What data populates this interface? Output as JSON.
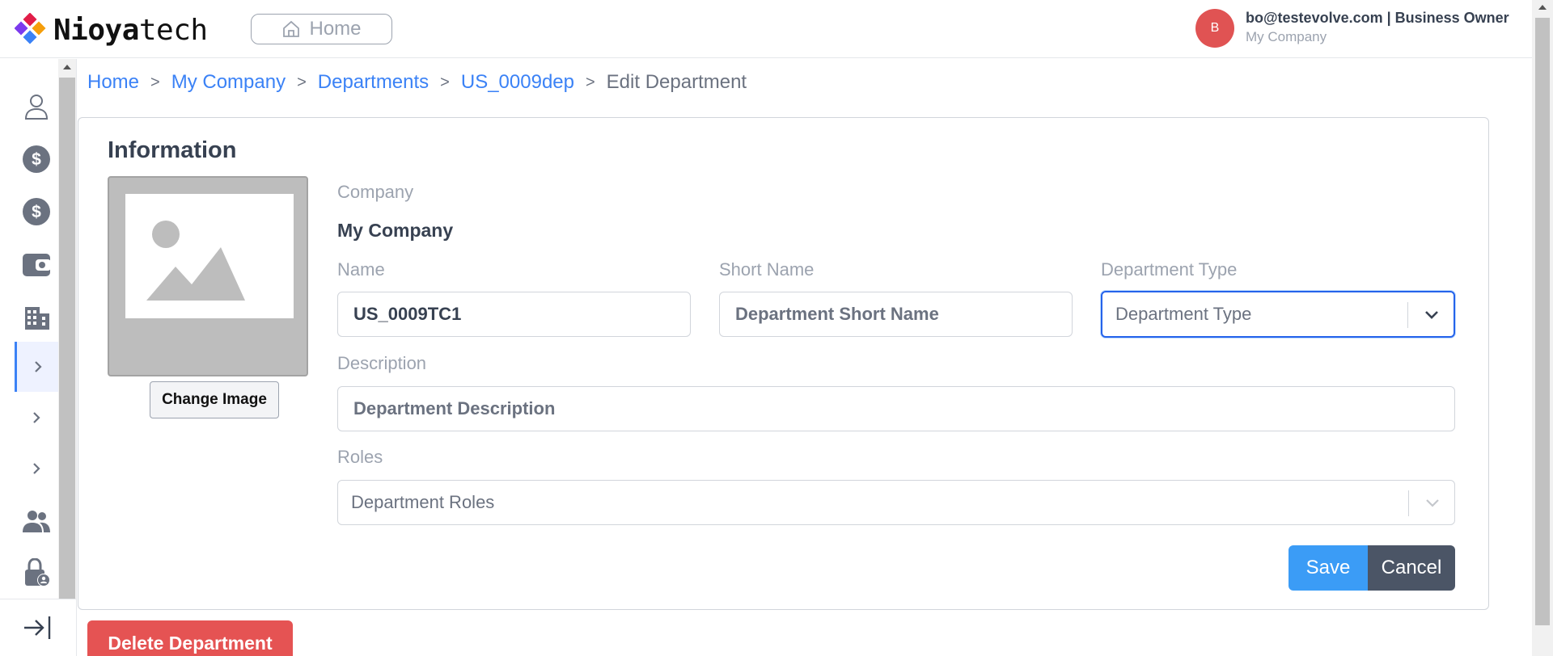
{
  "header": {
    "logo_bold": "Nioya",
    "logo_light": "tech",
    "home_label": "Home",
    "user_initial": "B",
    "user_email_role": "bo@testevolve.com | Business Owner",
    "user_company": "My Company"
  },
  "sidebar": {
    "items": [
      {
        "icon": "user-icon"
      },
      {
        "icon": "dollar-circle-icon"
      },
      {
        "icon": "dollar-circle-icon"
      },
      {
        "icon": "wallet-icon"
      },
      {
        "icon": "building-icon"
      },
      {
        "icon": "chevron-right-icon",
        "active": true
      },
      {
        "icon": "chevron-right-icon"
      },
      {
        "icon": "chevron-right-icon"
      },
      {
        "icon": "users-icon"
      },
      {
        "icon": "user-lock-icon"
      }
    ],
    "bottom_icon": "collapse-sidebar-icon"
  },
  "breadcrumb": {
    "items": [
      "Home",
      "My Company",
      "Departments",
      "US_0009dep"
    ],
    "separator": ">",
    "current": "Edit Department"
  },
  "form": {
    "title": "Information",
    "change_image_label": "Change Image",
    "company_label": "Company",
    "company_value": "My Company",
    "name_label": "Name",
    "name_value": "US_0009TC1",
    "short_name_label": "Short Name",
    "short_name_placeholder": "Department Short Name",
    "department_type_label": "Department Type",
    "department_type_placeholder": "Department Type",
    "description_label": "Description",
    "description_placeholder": "Department Description",
    "roles_label": "Roles",
    "roles_placeholder": "Department Roles",
    "save_label": "Save",
    "cancel_label": "Cancel"
  },
  "actions": {
    "delete_label": "Delete Department"
  },
  "colors": {
    "link": "#3b82f6",
    "save": "#3b9cf6",
    "cancel": "#4b5566",
    "delete": "#e55353",
    "avatar": "#e05353",
    "focus": "#2563eb"
  }
}
